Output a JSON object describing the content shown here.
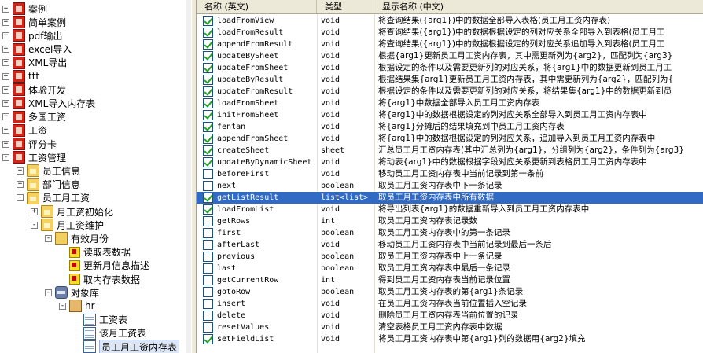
{
  "tree": {
    "items": [
      {
        "label": "案例",
        "level": 0,
        "expander": "+",
        "icon": "red"
      },
      {
        "label": "简单案例",
        "level": 0,
        "expander": "+",
        "icon": "red"
      },
      {
        "label": "pdf输出",
        "level": 0,
        "expander": "+",
        "icon": "red"
      },
      {
        "label": "excel导入",
        "level": 0,
        "expander": "+",
        "icon": "red"
      },
      {
        "label": "XML导出",
        "level": 0,
        "expander": "+",
        "icon": "red"
      },
      {
        "label": "ttt",
        "level": 0,
        "expander": "+",
        "icon": "red"
      },
      {
        "label": "体验开发",
        "level": 0,
        "expander": "+",
        "icon": "red"
      },
      {
        "label": "XML导入内存表",
        "level": 0,
        "expander": "+",
        "icon": "red"
      },
      {
        "label": "多国工资",
        "level": 0,
        "expander": "+",
        "icon": "red"
      },
      {
        "label": "工资",
        "level": 0,
        "expander": "+",
        "icon": "red"
      },
      {
        "label": "评分卡",
        "level": 0,
        "expander": "+",
        "icon": "red"
      },
      {
        "label": "工资管理",
        "level": 0,
        "expander": "-",
        "icon": "red"
      },
      {
        "label": "员工信息",
        "level": 1,
        "expander": "+",
        "icon": "folder"
      },
      {
        "label": "部门信息",
        "level": 1,
        "expander": "+",
        "icon": "folder"
      },
      {
        "label": "员工月工资",
        "level": 1,
        "expander": "-",
        "icon": "folder"
      },
      {
        "label": "月工资初始化",
        "level": 2,
        "expander": "+",
        "icon": "folder"
      },
      {
        "label": "月工资维护",
        "level": 2,
        "expander": "-",
        "icon": "folder"
      },
      {
        "label": "有效月份",
        "level": 3,
        "expander": "-",
        "icon": "tree"
      },
      {
        "label": "读取表数据",
        "level": 4,
        "expander": "",
        "icon": "yellow"
      },
      {
        "label": "更新月信息描述",
        "level": 4,
        "expander": "",
        "icon": "yellow"
      },
      {
        "label": "取内存表数据",
        "level": 4,
        "expander": "",
        "icon": "yellow"
      },
      {
        "label": "对象库",
        "level": 3,
        "expander": "-",
        "icon": "db"
      },
      {
        "label": "hr",
        "level": 4,
        "expander": "-",
        "icon": "user"
      },
      {
        "label": "工资表",
        "level": 5,
        "expander": "",
        "icon": "grid"
      },
      {
        "label": "该月工资表",
        "level": 5,
        "expander": "",
        "icon": "grid-pen"
      },
      {
        "label": "员工月工资内存表",
        "level": 5,
        "expander": "",
        "icon": "grid",
        "selected": true
      }
    ]
  },
  "grid": {
    "headers": {
      "name": "名称 (英文)",
      "type": "类型",
      "display": "显示名称 (中文)"
    },
    "rows": [
      {
        "checked": true,
        "name": "loadFromView",
        "type": "void",
        "display": "将查询结果({arg1})中的数据全部导入表格(员工月工资内存表)"
      },
      {
        "checked": true,
        "name": "loadFromResult",
        "type": "void",
        "display": "将查询结果({arg1})中的数据根据设定的列对应关系全部导入到表格(员工月工"
      },
      {
        "checked": true,
        "name": "appendFromResult",
        "type": "void",
        "display": "将查询结果({arg1})中的数据根据设定的列对应关系追加导入到表格(员工月工"
      },
      {
        "checked": true,
        "name": "updateBySheet",
        "type": "void",
        "display": "根据{arg1}更新员工月工资内存表，其中需更新列为{arg2}，匹配列为{arg3}"
      },
      {
        "checked": true,
        "name": "updateFromSheet",
        "type": "void",
        "display": "根据设定的条件以及需要更新列的对应关系，将{arg1}中的数据更新到员工月工"
      },
      {
        "checked": true,
        "name": "updateByResult",
        "type": "void",
        "display": "根据结果集{arg1}更新员工月工资内存表，其中需更新列为{arg2}，匹配列为{"
      },
      {
        "checked": true,
        "name": "updateFromResult",
        "type": "void",
        "display": "根据设定的条件以及需要更新列的对应关系，将结果集{arg1}中的数据更新到员"
      },
      {
        "checked": true,
        "name": "loadFromSheet",
        "type": "void",
        "display": "将{arg1}中数据全部导入员工月工资内存表"
      },
      {
        "checked": true,
        "name": "initFromSheet",
        "type": "void",
        "display": "将{arg1}中的数据根据设定的列对应关系全部导入到员工月工资内存表中"
      },
      {
        "checked": true,
        "name": "fentan",
        "type": "void",
        "display": "将{arg1}分摊后的结果填充到中员工月工资内存表"
      },
      {
        "checked": true,
        "name": "appendFromSheet",
        "type": "void",
        "display": "将{arg1}中的数据根据设定的列对应关系，追加导入到员工月工资内存表中"
      },
      {
        "checked": true,
        "name": "createSheet",
        "type": "sheet",
        "display": "汇总员工月工资内存表(其中汇总列为{arg1}，分组列为{arg2}，条件列为{arg3}"
      },
      {
        "checked": true,
        "name": "updateByDynamicSheet",
        "type": "void",
        "display": "将动表{arg1}中的数据根据字段对应关系更新到表格员工月工资内存表中"
      },
      {
        "checked": false,
        "name": "beforeFirst",
        "type": "void",
        "display": "移动员工月工资内存表中当前记录到第一条前"
      },
      {
        "checked": false,
        "name": "next",
        "type": "boolean",
        "display": "取员工月工资内存表中下一条记录"
      },
      {
        "checked": true,
        "name": "getListResult",
        "type": "list<list>",
        "display": "取员工月工资内存表中所有数据",
        "selected": true
      },
      {
        "checked": true,
        "name": "loadFromList",
        "type": "void",
        "display": "将导出列表{arg1}的数据重新导入到员工月工资内存表中"
      },
      {
        "checked": false,
        "name": "getRows",
        "type": "int",
        "display": "取员工月工资内存表记录数"
      },
      {
        "checked": false,
        "name": "first",
        "type": "boolean",
        "display": "取员工月工资内存表中的第一条记录"
      },
      {
        "checked": false,
        "name": "afterLast",
        "type": "void",
        "display": "移动员工月工资内存表中当前记录到最后一条后"
      },
      {
        "checked": false,
        "name": "previous",
        "type": "boolean",
        "display": "取员工月工资内存表中上一条记录"
      },
      {
        "checked": false,
        "name": "last",
        "type": "boolean",
        "display": "取员工月工资内存表中最后一条记录"
      },
      {
        "checked": false,
        "name": "getCurrentRow",
        "type": "int",
        "display": "得到员工月工资内存表当前记录位置"
      },
      {
        "checked": false,
        "name": "gotoRow",
        "type": "boolean",
        "display": "取员工月工资内存表的第{arg1}条记录"
      },
      {
        "checked": false,
        "name": "insert",
        "type": "void",
        "display": "在员工月工资内存表当前位置插入空记录"
      },
      {
        "checked": false,
        "name": "delete",
        "type": "void",
        "display": "删除员工月工资内存表当前位置的记录"
      },
      {
        "checked": false,
        "name": "resetValues",
        "type": "void",
        "display": "清空表格员工月工资内存表中数据"
      },
      {
        "checked": true,
        "name": "setFieldList",
        "type": "void",
        "display": "将员工月工资内存表中第{arg1}列的数据用{arg2}填充"
      }
    ]
  }
}
